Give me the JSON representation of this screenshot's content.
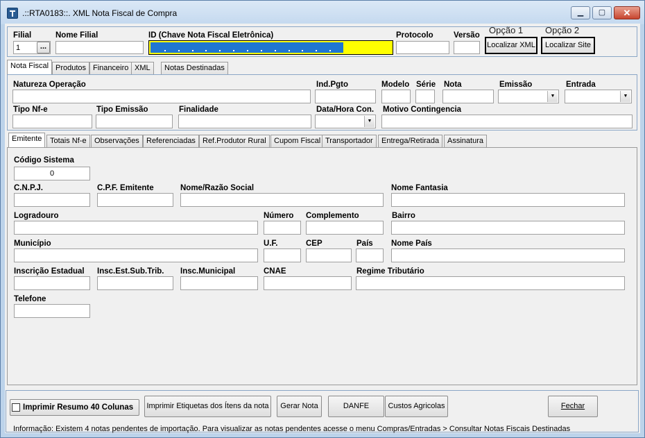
{
  "window": {
    "title": ".::RTA0183::. XML Nota Fiscal de Compra",
    "minimize_glyph": "▁",
    "maximize_glyph": "▢",
    "close_glyph": "✕",
    "icon": "app-logo-icon"
  },
  "header": {
    "filial_label": "Filial",
    "filial_value": "1",
    "filial_lookup": "...",
    "nome_filial_label": "Nome Filial",
    "id_label": "ID (Chave Nota Fiscal Eletrônica)",
    "id_progress": 0.8,
    "protocolo_label": "Protocolo",
    "versao_label": "Versão",
    "opcao1_label": "Opção 1",
    "opcao2_label": "Opção 2",
    "localizar_xml": "Localizar XML",
    "localizar_site": "Localizar Site"
  },
  "main_tabs": [
    "Nota Fiscal",
    "Produtos",
    "Financeiro",
    "XML",
    "Notas Destinadas"
  ],
  "nota_fiscal": {
    "natureza_operacao": "Natureza Operação",
    "ind_pgto": "Ind.Pgto",
    "modelo": "Modelo",
    "serie": "Série",
    "nota": "Nota",
    "emissao": "Emissão",
    "entrada": "Entrada",
    "tipo_nfe": "Tipo Nf-e",
    "tipo_emissao": "Tipo Emissão",
    "finalidade": "Finalidade",
    "data_hora_con": "Data/Hora Con.",
    "motivo_contingencia": "Motivo Contingencia",
    "dropdown_glyph": "▼"
  },
  "sub_tabs": [
    "Emitente",
    "Totais Nf-e",
    "Observações",
    "Referenciadas",
    "Ref.Produtor Rural",
    "Cupom Fiscal",
    "Transportador",
    "Entrega/Retirada",
    "Assinatura"
  ],
  "emitente": {
    "codigo_sistema_label": "Código Sistema",
    "codigo_sistema_value": "0",
    "cnpj": "C.N.P.J.",
    "cpf_emitente": "C.P.F. Emitente",
    "nome_razao_social": "Nome/Razão Social",
    "nome_fantasia": "Nome Fantasia",
    "logradouro": "Logradouro",
    "numero": "Número",
    "complemento": "Complemento",
    "bairro": "Bairro",
    "municipio": "Município",
    "uf": "U.F.",
    "cep": "CEP",
    "pais": "País",
    "nome_pais": "Nome País",
    "inscricao_estadual": "Inscrição Estadual",
    "insc_est_sub_trib": "Insc.Est.Sub.Trib.",
    "insc_municipal": "Insc.Municipal",
    "cnae": "CNAE",
    "regime_tributario": "Regime Tributário",
    "telefone": "Telefone"
  },
  "footer": {
    "imprimir_resumo": "Imprimir Resumo 40 Colunas",
    "imprimir_etiquetas": "Imprimir Etiquetas dos Ítens da nota",
    "gerar_nota": "Gerar Nota",
    "danfe": "DANFE",
    "custos_agricolas": "Custos Agricolas",
    "fechar": "Fechar",
    "info": "Informação: Existem 4 notas pendentes de importação. Para visualizar as notas pendentes acesse o menu Compras/Entradas > Consultar Notas Fiscais Destinadas"
  }
}
